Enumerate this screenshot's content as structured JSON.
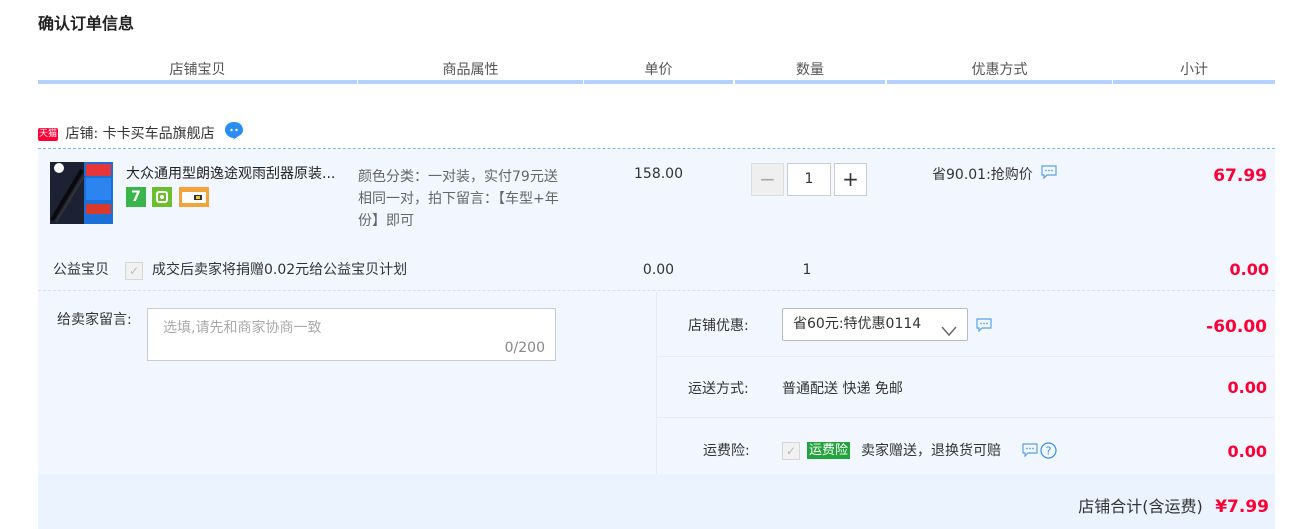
{
  "page_title": "确认订单信息",
  "columns": [
    "店铺宝贝",
    "商品属性",
    "单价",
    "数量",
    "优惠方式",
    "小计"
  ],
  "shop": {
    "label": "店铺:",
    "name": "卡卡买车品旗舰店",
    "tmall_badge": "天猫"
  },
  "item": {
    "title": "大众通用型朗逸途观雨刮器原装...",
    "attr_line1": "颜色分类：一对装，实付79元送",
    "attr_line2": "相同一对，拍下留言：【车型+年",
    "attr_line3": "份】即可",
    "unit_price": "158.00",
    "qty": "1",
    "discount": "省90.01:抢购价",
    "subtotal": "67.99",
    "badge_seven": "7"
  },
  "charity": {
    "label": "公益宝贝",
    "text": "成交后卖家将捐赠0.02元给公益宝贝计划",
    "price": "0.00",
    "qty": "1",
    "subtotal": "0.00"
  },
  "remark": {
    "label": "给卖家留言:",
    "placeholder": "选填,请先和商家协商一致",
    "counter": "0/200"
  },
  "shop_discount": {
    "label": "店铺优惠:",
    "selected": "省60元:特优惠0114",
    "amount": "-60.00"
  },
  "shipping": {
    "label": "运送方式:",
    "value": "普通配送 快递 免邮",
    "amount": "0.00"
  },
  "insurance": {
    "label": "运费险:",
    "badge": "运费险",
    "text": "卖家赠送，退换货可赔",
    "amount": "0.00"
  },
  "total": {
    "label": "店铺合计(含运费)",
    "amount": "¥7.99"
  },
  "colors": {
    "accent_red": "#ff0036",
    "header_bar": "#b2d1ff",
    "row_bg": "#f2f7ff"
  }
}
